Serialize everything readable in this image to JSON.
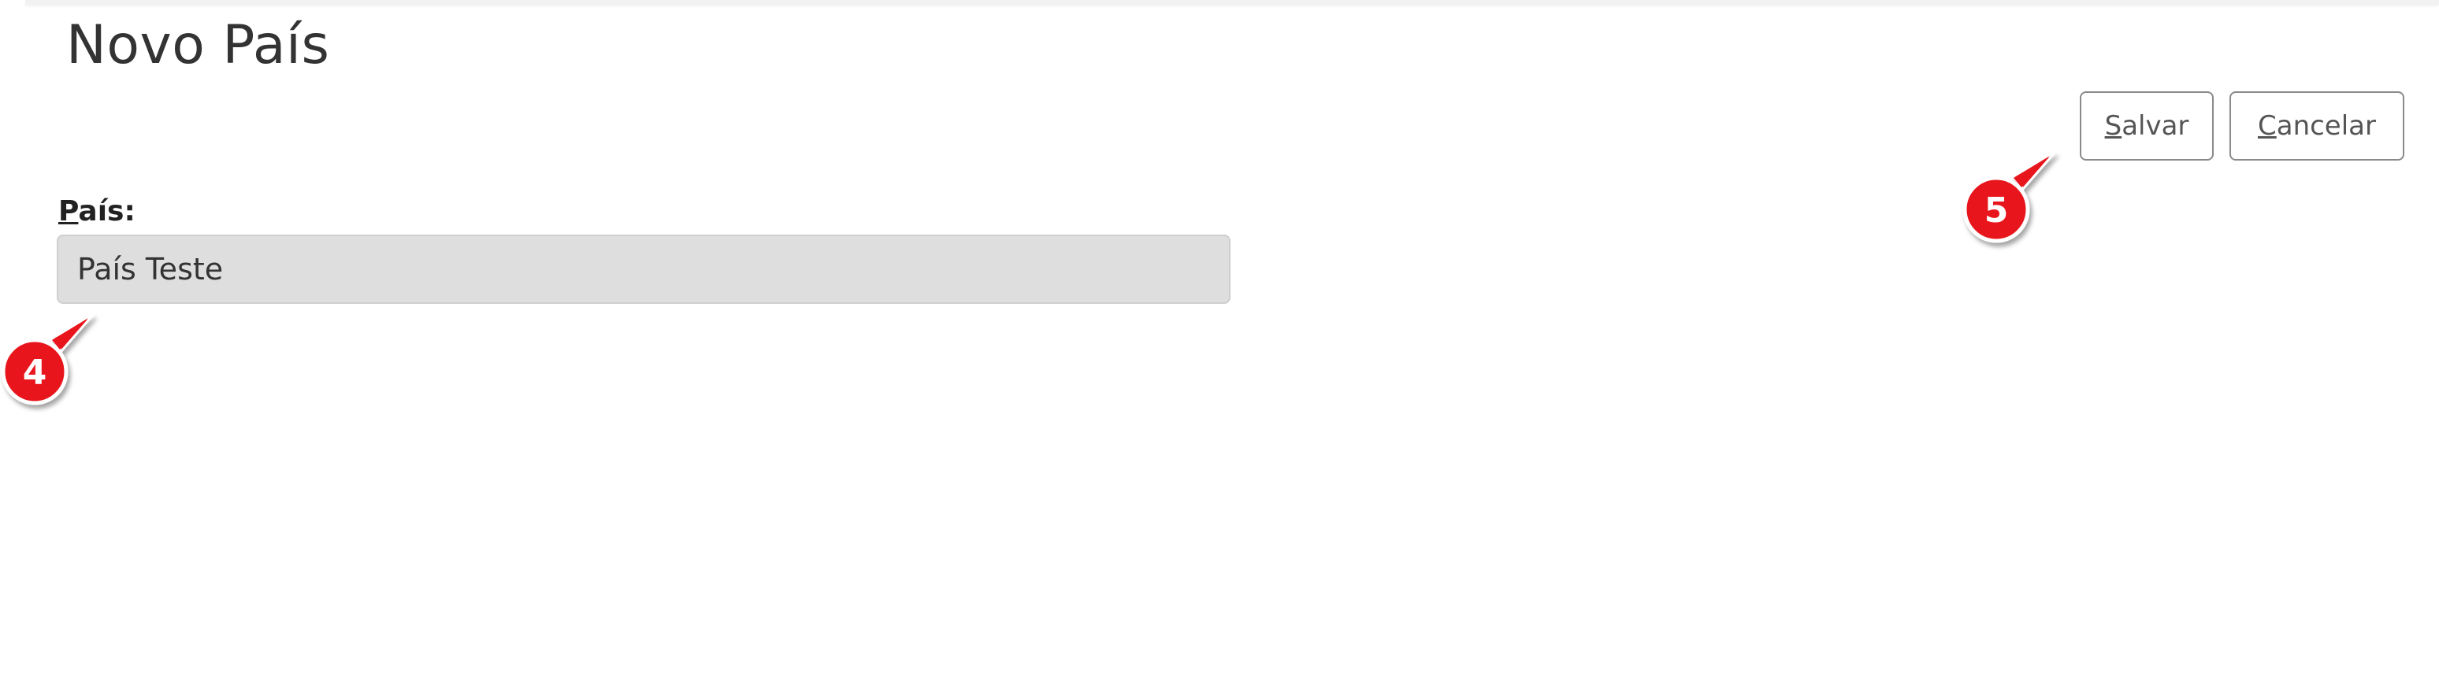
{
  "page": {
    "title": "Novo País"
  },
  "actions": {
    "save_key": "S",
    "save_rest": "alvar",
    "cancel_key": "C",
    "cancel_rest": "ancelar"
  },
  "form": {
    "pais": {
      "label_key": "P",
      "label_rest": "aís:",
      "value": "País Teste"
    }
  },
  "annotations": {
    "field_marker": "4",
    "buttons_marker": "5",
    "marker_color": "#e8141a"
  }
}
